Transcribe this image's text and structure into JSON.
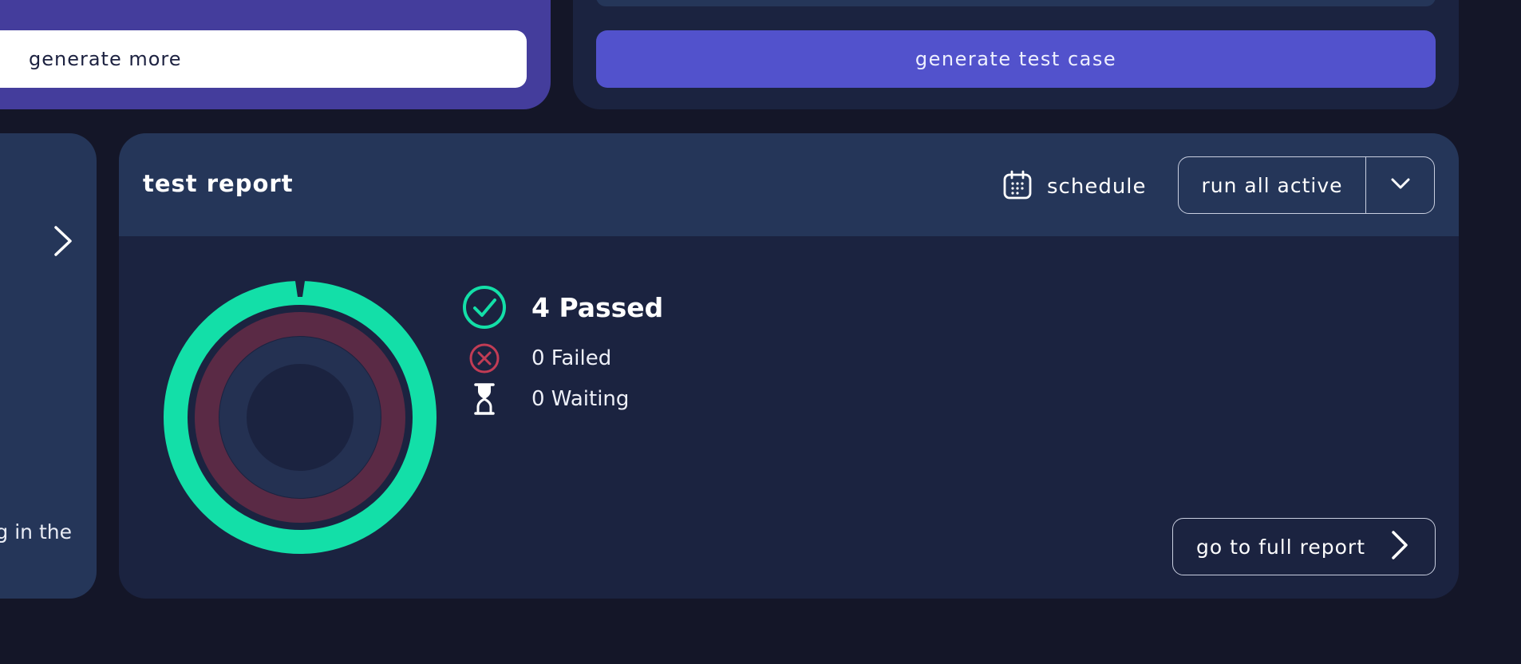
{
  "top_left_card": {
    "generate_more_label": "generate more"
  },
  "top_right_card": {
    "generate_test_case_label": "generate test case"
  },
  "left_card": {
    "partial_text": "g in the"
  },
  "test_report": {
    "title": "test report",
    "schedule_label": "schedule",
    "run_all_active_label": "run all active",
    "go_to_full_report_label": "go to full report",
    "results": {
      "passed_label": "4 Passed",
      "failed_label": "0 Failed",
      "waiting_label": "0 Waiting"
    },
    "counts": {
      "passed": 4,
      "failed": 0,
      "waiting": 0
    }
  },
  "colors": {
    "background": "#141628",
    "card": "#1b2340",
    "card_header": "#253659",
    "purple": "#443d9c",
    "primary_button": "#5252cc",
    "passed": "#13dfa8",
    "failed": "#c23c55",
    "waiting": "#2d3a5c"
  },
  "icons": {
    "schedule": "calendar-icon",
    "dropdown": "chevron-down-icon",
    "full_report": "chevron-right-icon",
    "passed": "check-circle-icon",
    "failed": "x-circle-icon",
    "waiting": "hourglass-icon",
    "left_nav": "chevron-right-icon"
  }
}
